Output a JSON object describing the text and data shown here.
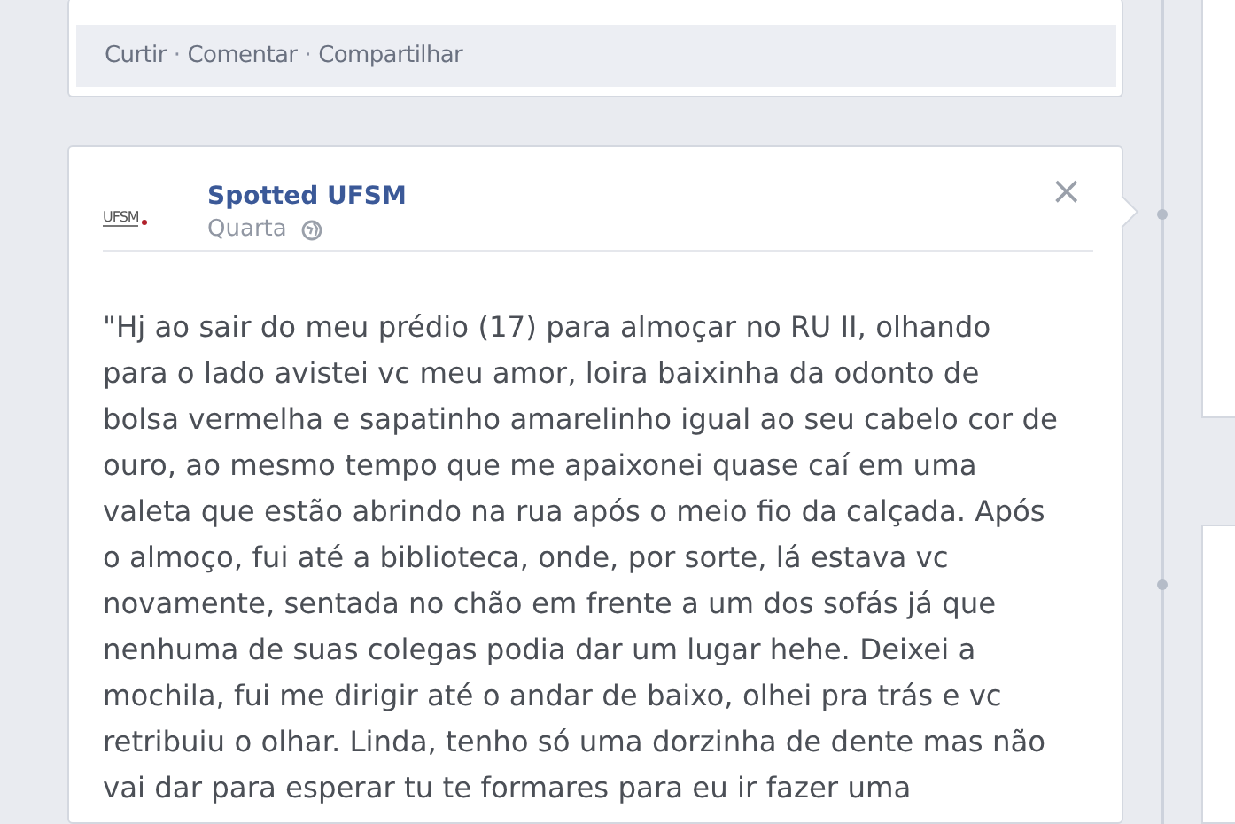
{
  "previous_post": {
    "actions": [
      "Curtir",
      "Comentar",
      "Compartilhar"
    ],
    "separator": "·"
  },
  "post": {
    "page_logo": "UFSM",
    "author": "Spotted UFSM",
    "time": "Quarta",
    "close": "×",
    "text_lines": [
      "\"Hj ao sair do meu prédio (17) para almoçar no RU II, olhando",
      "para o lado avistei vc meu amor, loira baixinha da odonto de",
      "bolsa vermelha e sapatinho amarelinho igual ao seu cabelo cor de",
      "ouro, ao mesmo tempo que me apaixonei quase caí em uma",
      "valeta que estão abrindo na rua após o meio fio da calçada. Após",
      "o almoço, fui até a biblioteca, onde, por sorte, lá estava vc",
      "novamente, sentada no chão em frente a um dos sofás já que",
      "nenhuma de suas colegas podia dar um lugar hehe. Deixei a",
      "mochila, fui me dirigir até o andar de baixo, olhei pra trás e vc",
      "retribuiu o olhar. Linda, tenho só uma dorzinha de dente mas não",
      "vai dar para esperar tu te formares para eu ir fazer uma"
    ]
  }
}
